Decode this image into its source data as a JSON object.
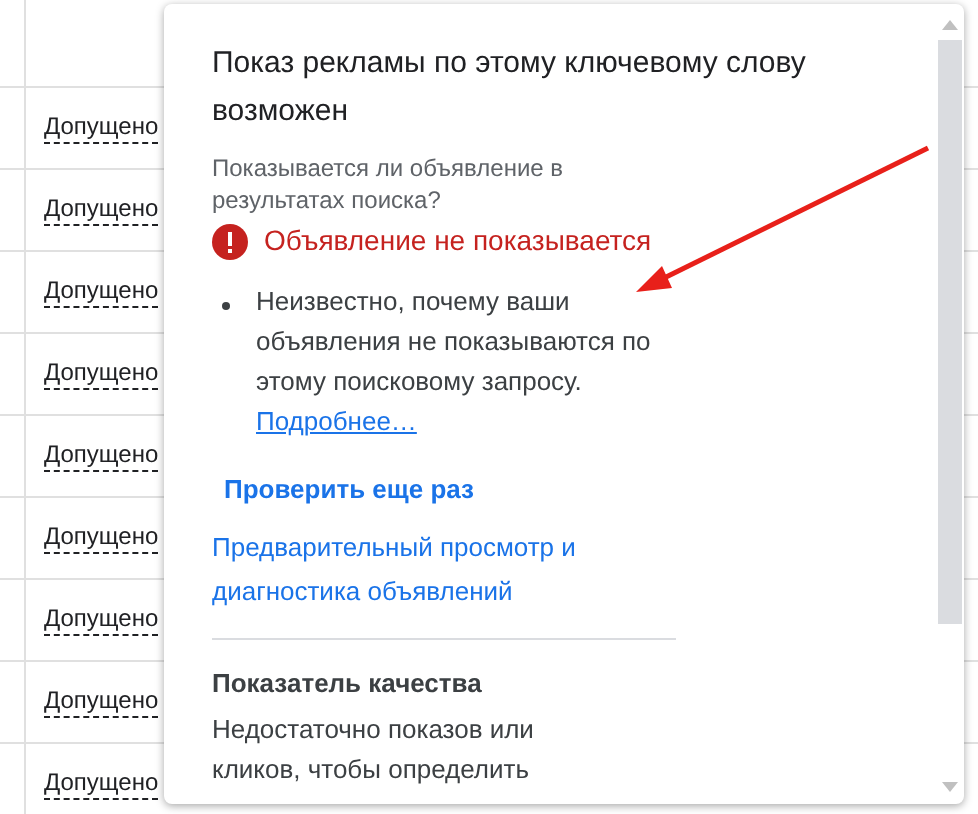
{
  "table": {
    "rows": [
      {
        "status": "Допущено"
      },
      {
        "status": "Допущено"
      },
      {
        "status": "Допущено"
      },
      {
        "status": "Допущено"
      },
      {
        "status": "Допущено"
      },
      {
        "status": "Допущено"
      },
      {
        "status": "Допущено"
      },
      {
        "status": "Допущено"
      },
      {
        "status": "Допущено"
      }
    ]
  },
  "popup": {
    "title": "Показ рекламы по этому ключевому слову возможен",
    "question": "Показывается ли объявление в результатах поиска?",
    "status": "Объявление не показывается",
    "reasons": [
      {
        "text": "Неизвестно, почему ваши объявления не показываются по этому поисковому запросу.",
        "link": "Подробнее…"
      }
    ],
    "recheck": "Проверить еще раз",
    "preview_link": "Предварительный просмотр и диагностика объявлений",
    "quality_heading": "Показатель качества",
    "quality_text": "Недостаточно показов или кликов, чтобы определить"
  }
}
